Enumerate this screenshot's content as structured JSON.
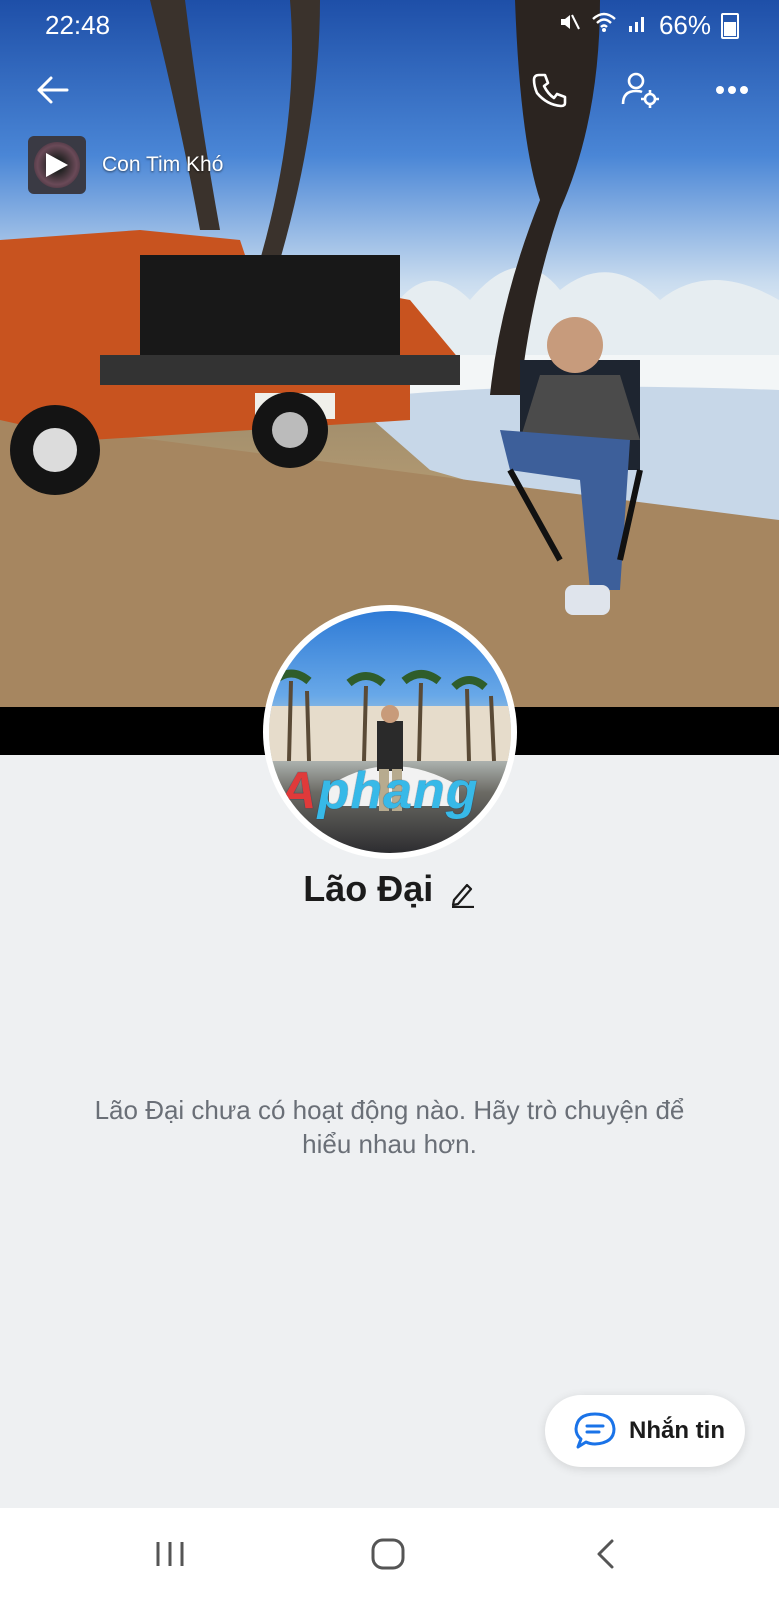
{
  "status_bar": {
    "time": "22:48",
    "battery": "66%"
  },
  "music": {
    "title": "Con Tim Khó"
  },
  "profile": {
    "name": "Lão Đại",
    "avatar_watermark_a": "A",
    "avatar_watermark_b": "phang"
  },
  "empty_state": {
    "message": "Lão Đại chưa có hoạt động nào. Hãy trò chuyện để hiểu nhau hơn."
  },
  "actions": {
    "message_button": "Nhắn tin"
  },
  "icons": {
    "back": "back-arrow-icon",
    "call": "phone-icon",
    "profile_settings": "user-gear-icon",
    "more": "more-dots-icon",
    "edit": "pencil-icon",
    "chat": "chat-bubble-icon",
    "nav_recent": "recent-apps-icon",
    "nav_home": "home-icon",
    "nav_back": "nav-back-icon"
  },
  "colors": {
    "accent": "#1a73e8",
    "background": "#eef0f2"
  }
}
